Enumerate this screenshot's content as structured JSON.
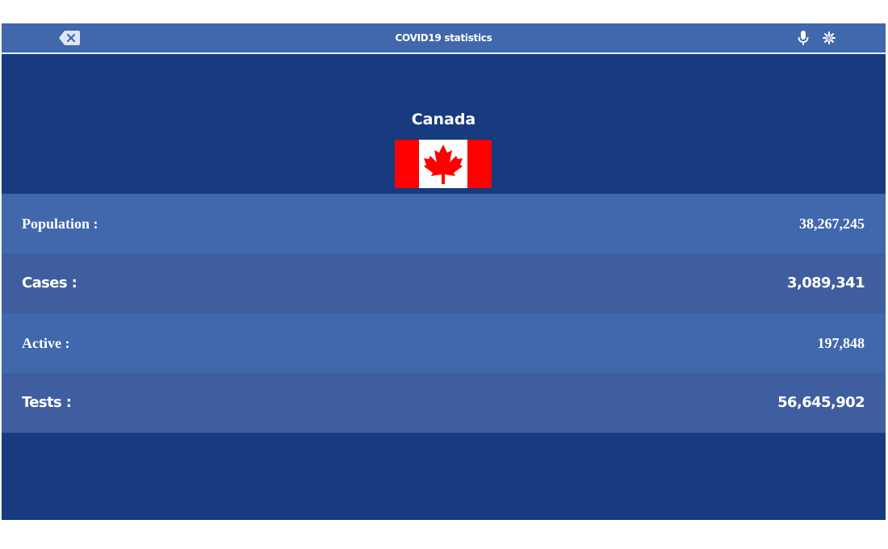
{
  "header": {
    "title": "COVID19 statistics",
    "back_icon": "backspace-icon",
    "mic_icon": "microphone-icon",
    "settings_icon": "gear-icon"
  },
  "country": {
    "name": "Canada",
    "flag_icon": "canada-flag-icon"
  },
  "stats": [
    {
      "label": "Population :",
      "value": "38,267,245"
    },
    {
      "label": "Cases :",
      "value": "3,089,341"
    },
    {
      "label": "Active :",
      "value": "197,848"
    },
    {
      "label": "Tests :",
      "value": "56,645,902"
    }
  ],
  "colors": {
    "background": "#173a80",
    "header": "#4167ad",
    "row_light": "#4167ad",
    "row_dark": "#3e5e9f",
    "flag_red": "#ff0000"
  }
}
